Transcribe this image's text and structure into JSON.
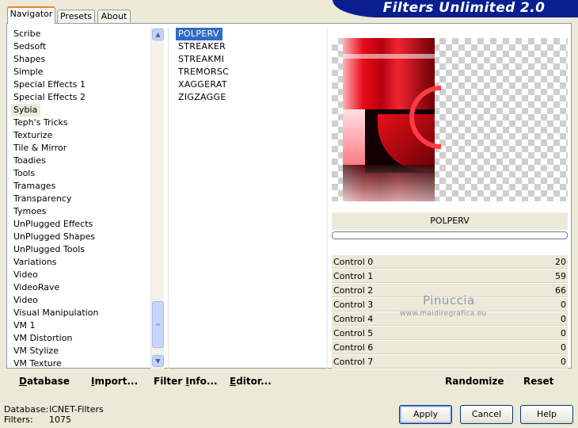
{
  "app": {
    "title": "Filters Unlimited 2.0"
  },
  "tabs": [
    {
      "label": "Navigator",
      "active": true
    },
    {
      "label": "Presets",
      "active": false
    },
    {
      "label": "About",
      "active": false
    }
  ],
  "categories": {
    "items": [
      "Scribe",
      "Sedsoft",
      "Shapes",
      "Simple",
      "Special Effects 1",
      "Special Effects 2",
      "Sybia",
      "Teph's Tricks",
      "Texturize",
      "Tile & Mirror",
      "Toadies",
      "Tools",
      "Tramages",
      "Transparency",
      "Tymoes",
      "UnPlugged Effects",
      "UnPlugged Shapes",
      "UnPlugged Tools",
      "Variations",
      "Video",
      "VideoRave",
      "Video",
      "Visual Manipulation",
      "VM 1",
      "VM Distortion",
      "VM Stylize",
      "VM Texture"
    ],
    "selected": "Sybia",
    "scroll_up_icon": "arrow-up-icon",
    "scroll_down_icon": "arrow-down-icon"
  },
  "filters": {
    "items": [
      "POLPERV",
      "STREAKER",
      "STREAKMI",
      "TREMORSC",
      "XAGGERAT",
      "ZIGZAGGE"
    ],
    "selected": "POLPERV"
  },
  "preview": {
    "filter_name": "POLPERV",
    "progress_percent": 0
  },
  "controls": [
    {
      "label": "Control 0",
      "value": "20"
    },
    {
      "label": "Control 1",
      "value": "59"
    },
    {
      "label": "Control 2",
      "value": "66"
    },
    {
      "label": "Control 3",
      "value": "0"
    },
    {
      "label": "Control 4",
      "value": "0"
    },
    {
      "label": "Control 5",
      "value": "0"
    },
    {
      "label": "Control 6",
      "value": "0"
    },
    {
      "label": "Control 7",
      "value": "0"
    }
  ],
  "watermark": {
    "line1": "Pinuccia",
    "line2": "www.maidiregrafica.eu"
  },
  "toolbar": {
    "database": {
      "hotkey": "D",
      "rest": "atabase"
    },
    "import": {
      "hotkey": "I",
      "rest": "mport..."
    },
    "filter_info": {
      "prefix": "Filter ",
      "hotkey": "I",
      "rest": "nfo..."
    },
    "editor": {
      "hotkey": "E",
      "rest": "ditor..."
    },
    "randomize": "Randomize",
    "reset": "Reset"
  },
  "status": {
    "database_label": "Database:",
    "database_value": "ICNET-Filters",
    "filters_label": "Filters:",
    "filters_value": "1075"
  },
  "buttons": {
    "apply": "Apply",
    "cancel": "Cancel",
    "help": "Help"
  },
  "colors": {
    "banner": "#0a1f8f",
    "selection": "#316ac5",
    "preview_red": "#e8101a"
  }
}
